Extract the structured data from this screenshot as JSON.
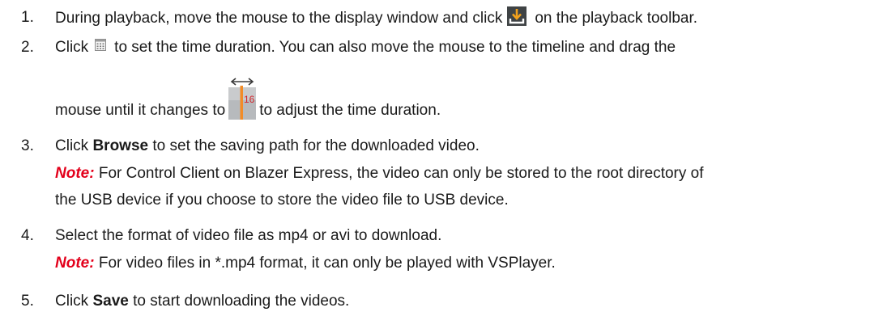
{
  "steps": [
    {
      "number": "1.",
      "before": "During playback, move the mouse to the display window and click",
      "icon": "download-icon",
      "after": "on the playback toolbar."
    },
    {
      "number": "2.",
      "before": "Click",
      "icon": "calendar-icon",
      "after": "to set the time duration. You can also move the mouse to the timeline and drag the",
      "line2_before": "mouse until it changes to",
      "icon2": "timeline-drag-icon",
      "icon2_text": "16",
      "line2_after": "to adjust the time duration."
    },
    {
      "number": "3.",
      "before": "Click",
      "bold": "Browse",
      "after": "to set the saving path for the downloaded video.",
      "note_label": "Note:",
      "note_line1": "For Control Client on Blazer Express, the video can only be stored to the root directory of",
      "note_line2": "the USB device if you choose to store the video file to USB device."
    },
    {
      "number": "4.",
      "text": "Select the format of video file as mp4 or avi to download.",
      "note_label": "Note:",
      "note_text": "For video files in *.mp4 format, it can only be played with VSPlayer."
    },
    {
      "number": "5.",
      "before": "Click",
      "bold": "Save",
      "after": "to start downloading the videos."
    }
  ],
  "colors": {
    "text": "#1a1a1a",
    "note": "#e3001b",
    "download_icon_bg": "#3f4345",
    "download_arrow": "#f2a11c",
    "drag_bar": "#f28c28"
  }
}
